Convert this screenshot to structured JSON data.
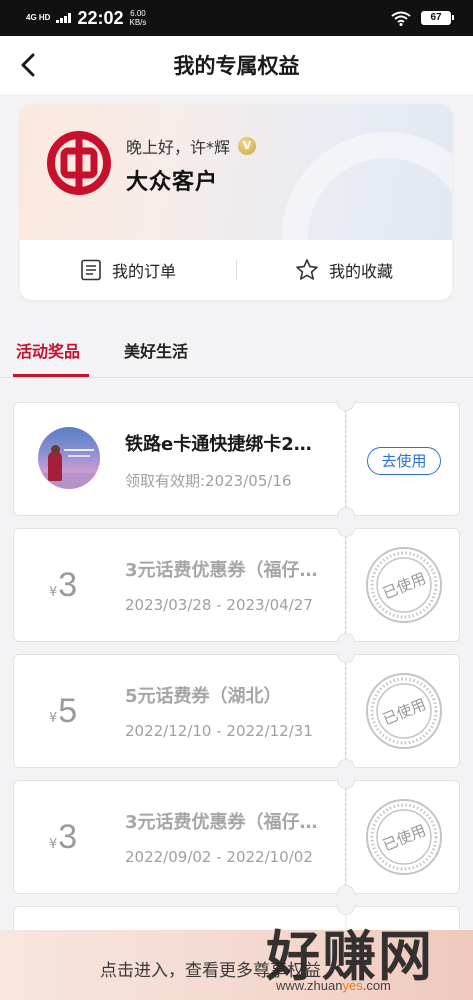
{
  "status_bar": {
    "network": "4G HD",
    "time": "22:02",
    "speed_value": "6.00",
    "speed_unit": "KB/s",
    "battery": "67"
  },
  "nav": {
    "title": "我的专属权益",
    "back_icon": "chevron-left-icon"
  },
  "profile": {
    "greeting": "晚上好，许*辉",
    "vip_badge": "V",
    "level": "大众客户",
    "actions": [
      {
        "label": "我的订单",
        "icon": "order-list-icon"
      },
      {
        "label": "我的收藏",
        "icon": "star-outline-icon"
      }
    ]
  },
  "tabs": [
    {
      "label": "活动奖品",
      "active": true
    },
    {
      "label": "美好生活",
      "active": false
    }
  ],
  "coupons": [
    {
      "type": "image",
      "title": "铁路e卡通快捷绑卡2…",
      "date": "领取有效期:2023/05/16",
      "action": "去使用",
      "status": "active"
    },
    {
      "type": "price",
      "currency": "¥",
      "amount": "3",
      "title": "3元话费优惠券（福仔…",
      "date": "2023/03/28 - 2023/04/27",
      "stamp": "已使用",
      "status": "used"
    },
    {
      "type": "price",
      "currency": "¥",
      "amount": "5",
      "title": "5元话费券（湖北）",
      "date": "2022/12/10 - 2022/12/31",
      "stamp": "已使用",
      "status": "used"
    },
    {
      "type": "price",
      "currency": "¥",
      "amount": "3",
      "title": "3元话费优惠券（福仔…",
      "date": "2022/09/02 - 2022/10/02",
      "stamp": "已使用",
      "status": "used"
    }
  ],
  "footer": {
    "text": "点击进入，查看更多尊享权益"
  },
  "watermark": {
    "big": "好赚网",
    "url_prefix": "www.zhuan",
    "url_accent": "yes",
    "url_suffix": ".com"
  },
  "colors": {
    "brand_red": "#c8102e",
    "action_blue": "#2e6fd8",
    "muted_gray": "#a0a0a0"
  }
}
